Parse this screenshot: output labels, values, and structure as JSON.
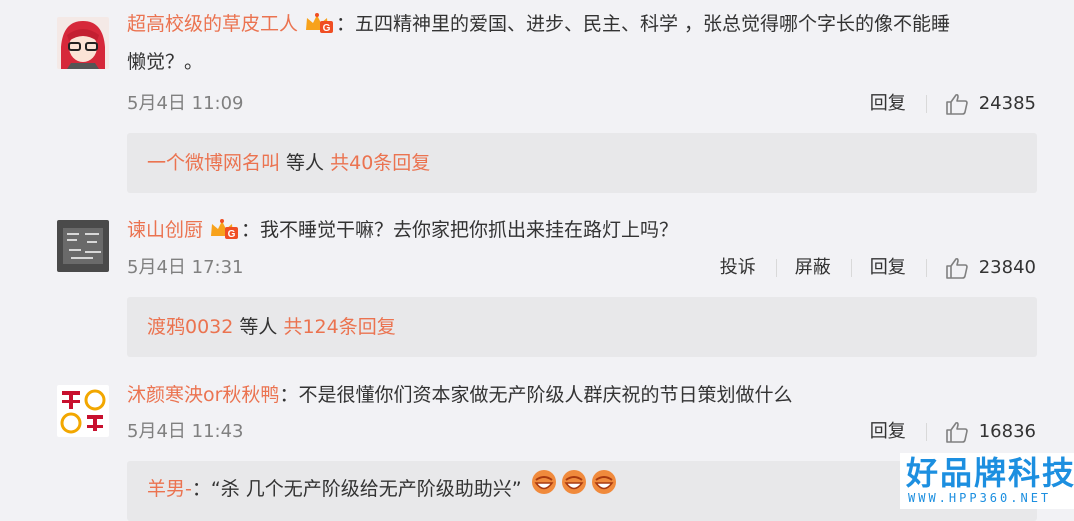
{
  "comments": [
    {
      "username": "超高校级的草皮工人",
      "text": "：五四精神里的爱国、进步、民主、科学 ，张总觉得哪个字长的像不能睡",
      "text_line2": "懒觉？。",
      "date": "5月4日 11:09",
      "actions": [
        "回复"
      ],
      "likes": "24385",
      "replies": {
        "users": "一个微博网名叫",
        "mid": " 等人 ",
        "count": "共40条回复"
      }
    },
    {
      "username": "谏山创厨",
      "text": "：我不睡觉干嘛？去你家把你抓出来挂在路灯上吗？",
      "date": "5月4日 17:31",
      "actions": [
        "投诉",
        "屏蔽",
        "回复"
      ],
      "likes": "23840",
      "replies": {
        "users": "渡鸦0032",
        "mid": " 等人 ",
        "count": "共124条回复"
      }
    },
    {
      "username": "沐颜寒泱or秋秋鸭",
      "text": "：不是很懂你们资本家做无产阶级人群庆祝的节日策划做什么",
      "date": "5月4日 11:43",
      "actions": [
        "回复"
      ],
      "likes": "16836",
      "reply_preview": {
        "user": "羊男-",
        "text": "：“杀 几个无产阶级给无产阶级助助兴”"
      }
    }
  ],
  "icons": {
    "badge": "vip-crown-icon",
    "like": "thumbs-up-icon",
    "emoji": "laughing-emoji-icon"
  },
  "colors": {
    "username": "#eb7350",
    "background": "#f2f2f5",
    "reply_box": "#e8e8ea"
  },
  "watermark": {
    "title": "好品牌科技网",
    "url": "WWW.HPP360.NET"
  }
}
